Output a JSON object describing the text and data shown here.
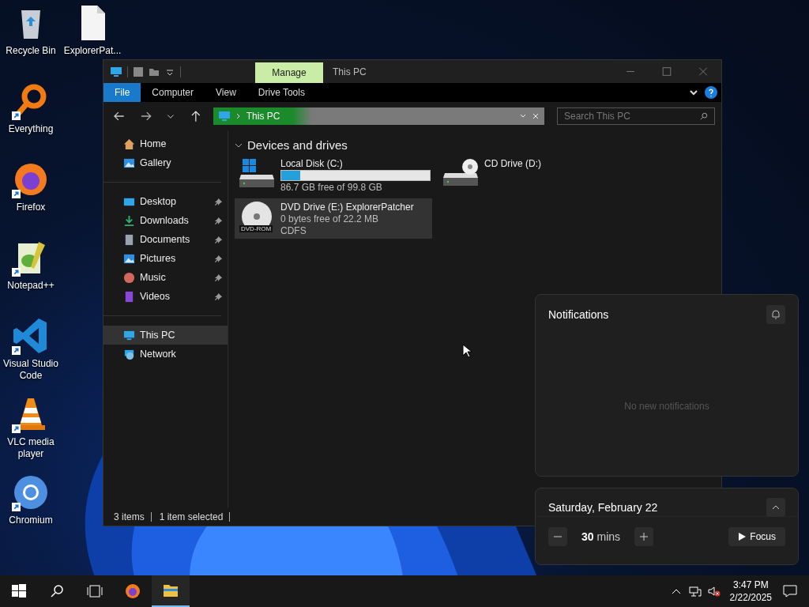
{
  "desktop_icons": [
    {
      "label": "Recycle Bin",
      "kind": "recycle",
      "shortcut": false
    },
    {
      "label": "ExplorerPat...",
      "kind": "file",
      "shortcut": false
    },
    {
      "label": "Everything",
      "kind": "everything",
      "shortcut": true
    },
    {
      "label": "Firefox",
      "kind": "firefox",
      "shortcut": true
    },
    {
      "label": "Notepad++",
      "kind": "notepad",
      "shortcut": true
    },
    {
      "label": "Visual Studio Code",
      "kind": "vscode",
      "shortcut": true
    },
    {
      "label": "VLC media player",
      "kind": "vlc",
      "shortcut": true
    },
    {
      "label": "Chromium",
      "kind": "chromium",
      "shortcut": true
    }
  ],
  "explorer": {
    "title": "This PC",
    "contextual_tab": "Manage",
    "ribbon_tabs": [
      {
        "label": "File",
        "kind": "file",
        "selected": false
      },
      {
        "label": "Computer",
        "kind": "tab",
        "selected": false
      },
      {
        "label": "View",
        "kind": "tab",
        "selected": false
      },
      {
        "label": "Drive Tools",
        "kind": "tab",
        "selected": false
      }
    ],
    "address": {
      "path": "This PC",
      "level": 0.3
    },
    "search": {
      "placeholder": "Search This PC"
    },
    "nav": [
      [
        {
          "label": "Home",
          "kind": "home",
          "pinned": false,
          "selected": false
        },
        {
          "label": "Gallery",
          "kind": "gallery",
          "pinned": false,
          "selected": false
        }
      ],
      [
        {
          "label": "Desktop",
          "kind": "desktop",
          "pinned": true,
          "selected": false
        },
        {
          "label": "Downloads",
          "kind": "downloads",
          "pinned": true,
          "selected": false
        },
        {
          "label": "Documents",
          "kind": "documents",
          "pinned": true,
          "selected": false
        },
        {
          "label": "Pictures",
          "kind": "pictures",
          "pinned": true,
          "selected": false
        },
        {
          "label": "Music",
          "kind": "music",
          "pinned": true,
          "selected": false
        },
        {
          "label": "Videos",
          "kind": "videos",
          "pinned": true,
          "selected": false
        }
      ],
      [
        {
          "label": "This PC",
          "kind": "pc",
          "pinned": false,
          "selected": true
        },
        {
          "label": "Network",
          "kind": "network",
          "pinned": false,
          "selected": false
        }
      ]
    ],
    "section": {
      "title": "Devices and drives",
      "expanded": true
    },
    "drives": [
      {
        "name": "Local Disk (C:)",
        "kind": "system",
        "level": 0.13,
        "info": [
          "86.7 GB free of 99.8 GB"
        ],
        "selected": false
      },
      {
        "name": "CD Drive (D:)",
        "kind": "cd",
        "selected": false
      },
      {
        "name": "DVD Drive (E:) ExplorerPatcher",
        "kind": "dvd",
        "icon_label": "DVD-ROM",
        "info": [
          "0 bytes free of 22.2 MB",
          "CDFS"
        ],
        "selected": true
      }
    ],
    "status": [
      "3 items",
      "1 item selected"
    ]
  },
  "notifications": {
    "title": "Notifications",
    "empty_text": "No new notifications"
  },
  "calendar": {
    "date": "Saturday, February 22",
    "focus_value": "30",
    "focus_unit": "mins",
    "focus_button": "Focus"
  },
  "taskbar": {
    "items": [
      {
        "kind": "start",
        "active": false
      },
      {
        "kind": "search",
        "active": false
      },
      {
        "kind": "taskview",
        "active": false
      },
      {
        "kind": "firefox",
        "active": false
      },
      {
        "kind": "explorer",
        "active": true
      }
    ],
    "time": "3:47 PM",
    "date": "2/22/2025"
  }
}
